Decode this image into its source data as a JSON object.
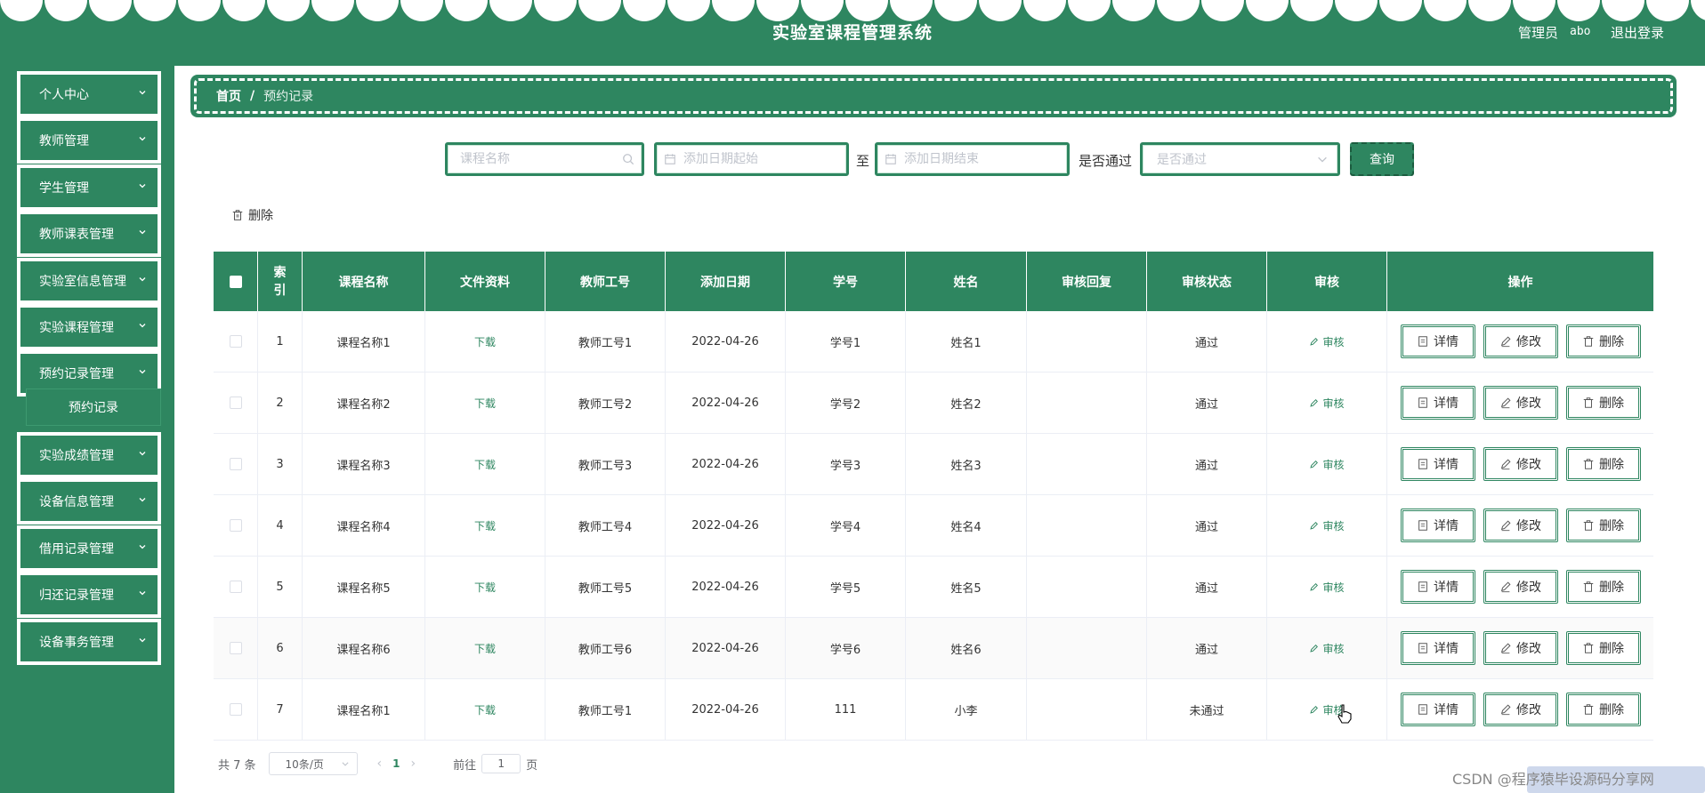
{
  "header": {
    "title": "实验室课程管理系统",
    "user_role": "管理员",
    "user_name": "abo",
    "logout": "退出登录"
  },
  "colors": {
    "primary": "#2e8660",
    "accent_light": "#c8e6d6"
  },
  "sidebar": {
    "items": [
      {
        "label": "个人中心"
      },
      {
        "label": "教师管理"
      },
      {
        "label": "学生管理"
      },
      {
        "label": "教师课表管理"
      },
      {
        "label": "实验室信息管理"
      },
      {
        "label": "实验课程管理"
      },
      {
        "label": "预约记录管理",
        "expanded": true,
        "children": [
          {
            "label": "预约记录",
            "active": true
          }
        ]
      },
      {
        "label": "实验成绩管理"
      },
      {
        "label": "设备信息管理"
      },
      {
        "label": "借用记录管理"
      },
      {
        "label": "归还记录管理"
      },
      {
        "label": "设备事务管理"
      }
    ]
  },
  "breadcrumb": {
    "home": "首页",
    "separator": "/",
    "current": "预约记录"
  },
  "search": {
    "course_placeholder": "课程名称",
    "date_start_placeholder": "添加日期起始",
    "to_label": "至",
    "date_end_placeholder": "添加日期结束",
    "pass_label": "是否通过",
    "pass_placeholder": "是否通过",
    "query_button": "查询"
  },
  "toolbar": {
    "delete_label": "删除"
  },
  "table": {
    "headers": [
      "索引",
      "课程名称",
      "文件资料",
      "教师工号",
      "添加日期",
      "学号",
      "姓名",
      "审核回复",
      "审核状态",
      "审核",
      "操作"
    ],
    "download_label": "下载",
    "audit_label": "审核",
    "actions": {
      "detail": "详情",
      "edit": "修改",
      "delete": "删除"
    },
    "rows": [
      {
        "index": "1",
        "course": "课程名称1",
        "teacher_no": "教师工号1",
        "date": "2022-04-26",
        "student_no": "学号1",
        "student_name": "姓名1",
        "reply": "",
        "status": "通过"
      },
      {
        "index": "2",
        "course": "课程名称2",
        "teacher_no": "教师工号2",
        "date": "2022-04-26",
        "student_no": "学号2",
        "student_name": "姓名2",
        "reply": "",
        "status": "通过"
      },
      {
        "index": "3",
        "course": "课程名称3",
        "teacher_no": "教师工号3",
        "date": "2022-04-26",
        "student_no": "学号3",
        "student_name": "姓名3",
        "reply": "",
        "status": "通过"
      },
      {
        "index": "4",
        "course": "课程名称4",
        "teacher_no": "教师工号4",
        "date": "2022-04-26",
        "student_no": "学号4",
        "student_name": "姓名4",
        "reply": "",
        "status": "通过"
      },
      {
        "index": "5",
        "course": "课程名称5",
        "teacher_no": "教师工号5",
        "date": "2022-04-26",
        "student_no": "学号5",
        "student_name": "姓名5",
        "reply": "",
        "status": "通过"
      },
      {
        "index": "6",
        "course": "课程名称6",
        "teacher_no": "教师工号6",
        "date": "2022-04-26",
        "student_no": "学号6",
        "student_name": "姓名6",
        "reply": "",
        "status": "通过"
      },
      {
        "index": "7",
        "course": "课程名称1",
        "teacher_no": "教师工号1",
        "date": "2022-04-26",
        "student_no": "111",
        "student_name": "小李",
        "reply": "",
        "status": "未通过"
      }
    ]
  },
  "pagination": {
    "total_text": "共 7 条",
    "page_size": "10条/页",
    "current_page": "1",
    "goto_label": "前往",
    "goto_value": "1",
    "page_suffix": "页"
  },
  "watermark": "CSDN @程序猿毕设源码分享网",
  "icons": [
    "search-icon",
    "calendar-icon",
    "chevron-down-icon",
    "trash-icon",
    "edit-icon",
    "document-icon",
    "chevron-left-icon",
    "chevron-right-icon"
  ]
}
